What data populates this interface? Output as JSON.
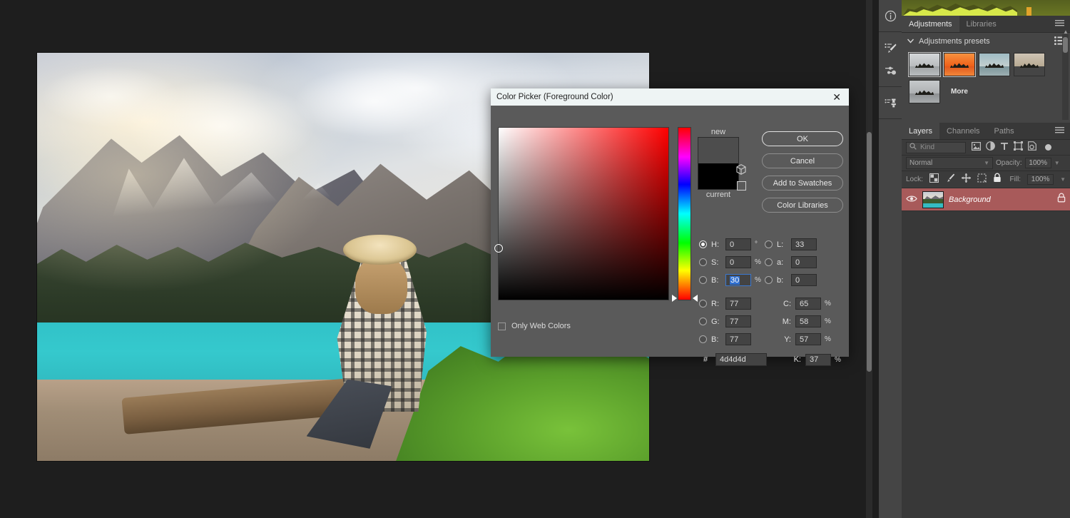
{
  "dialog": {
    "title": "Color Picker (Foreground Color)",
    "close_icon": "close-icon",
    "swatch": {
      "new_label": "new",
      "current_label": "current",
      "new_color": "#4d4d4d",
      "current_color": "#000000"
    },
    "buttons": {
      "ok": "OK",
      "cancel": "Cancel",
      "add_to_swatches": "Add to Swatches",
      "color_libraries": "Color Libraries"
    },
    "only_web_colors": {
      "label": "Only Web Colors",
      "checked": false
    },
    "hsb": [
      {
        "name": "H",
        "label": "H:",
        "value": "0",
        "unit": "°",
        "selected": true
      },
      {
        "name": "S",
        "label": "S:",
        "value": "0",
        "unit": "%",
        "selected": false
      },
      {
        "name": "B",
        "label": "B:",
        "value": "30",
        "unit": "%",
        "selected": false,
        "focused": true
      }
    ],
    "lab": [
      {
        "name": "L",
        "label": "L:",
        "value": "33",
        "unit": ""
      },
      {
        "name": "a",
        "label": "a:",
        "value": "0",
        "unit": ""
      },
      {
        "name": "b",
        "label": "b:",
        "value": "0",
        "unit": ""
      }
    ],
    "rgb": [
      {
        "name": "R",
        "label": "R:",
        "value": "77"
      },
      {
        "name": "G",
        "label": "G:",
        "value": "77"
      },
      {
        "name": "B",
        "label": "B:",
        "value": "77"
      }
    ],
    "cmyk": [
      {
        "name": "C",
        "label": "C:",
        "value": "65",
        "unit": "%"
      },
      {
        "name": "M",
        "label": "M:",
        "value": "58",
        "unit": "%"
      },
      {
        "name": "Y",
        "label": "Y:",
        "value": "57",
        "unit": "%"
      },
      {
        "name": "K",
        "label": "K:",
        "value": "37",
        "unit": "%"
      }
    ],
    "hex": {
      "label": "#",
      "value": "4d4d4d"
    }
  },
  "rail": {
    "items": [
      {
        "name": "info-icon",
        "label": "Info"
      },
      {
        "name": "brush-settings-icon",
        "label": "Brush Settings"
      },
      {
        "name": "brushes-icon",
        "label": "Brushes"
      },
      {
        "name": "clone-source-icon",
        "label": "Clone Source"
      }
    ]
  },
  "adjustments_panel": {
    "tabs": [
      {
        "label": "Adjustments",
        "active": true
      },
      {
        "label": "Libraries",
        "active": false
      }
    ],
    "menu_icon": "panel-menu-icon",
    "presets": {
      "title": "Adjustments presets",
      "collapse_icon": "chevron-down-icon",
      "list_icon": "list-view-icon",
      "more_label": "More",
      "thumbs": [
        {
          "name": "preset-bw",
          "sky": "#c9ccce",
          "water": "#9ea2a4",
          "selected": false
        },
        {
          "name": "preset-sunset",
          "sky": "#f0722a",
          "water": "#e0581c",
          "selected": true
        },
        {
          "name": "preset-cool",
          "sky": "#8fb0b8",
          "water": "#7b949a",
          "selected": false
        },
        {
          "name": "preset-sepia",
          "sky": "#c9bfae",
          "water": "#8f8268",
          "selected": false
        },
        {
          "name": "preset-gray",
          "sky": "#b9bcbe",
          "water": "#8d9092",
          "selected": false
        }
      ]
    }
  },
  "layers_panel": {
    "tabs": [
      {
        "label": "Layers",
        "active": true
      },
      {
        "label": "Channels",
        "active": false
      },
      {
        "label": "Paths",
        "active": false
      }
    ],
    "menu_icon": "panel-menu-icon",
    "filter": {
      "search_icon": "search-icon",
      "kind_label": "Kind",
      "icons": [
        {
          "name": "filter-pixel-icon"
        },
        {
          "name": "filter-adjustment-icon"
        },
        {
          "name": "filter-type-icon"
        },
        {
          "name": "filter-shape-icon"
        },
        {
          "name": "filter-smart-object-icon"
        }
      ],
      "toggle_name": "filter-enable-toggle"
    },
    "blend": {
      "mode": "Normal",
      "opacity_label": "Opacity:",
      "opacity_value": "100%"
    },
    "lock": {
      "label": "Lock:",
      "icons": [
        {
          "name": "lock-transparency-icon"
        },
        {
          "name": "lock-image-icon"
        },
        {
          "name": "lock-position-icon"
        },
        {
          "name": "lock-artboard-icon"
        },
        {
          "name": "lock-all-icon"
        }
      ],
      "fill_label": "Fill:",
      "fill_value": "100%"
    },
    "layers": [
      {
        "name": "Background",
        "visible": true,
        "locked": true,
        "selected": true,
        "visibility_icon": "eye-icon",
        "lock_icon": "lock-icon"
      }
    ],
    "selection_color": "#a85a5a"
  },
  "canvas": {
    "document_name": "Mountain lake photograph",
    "scrollbar_name": "canvas-vertical-scrollbar"
  }
}
